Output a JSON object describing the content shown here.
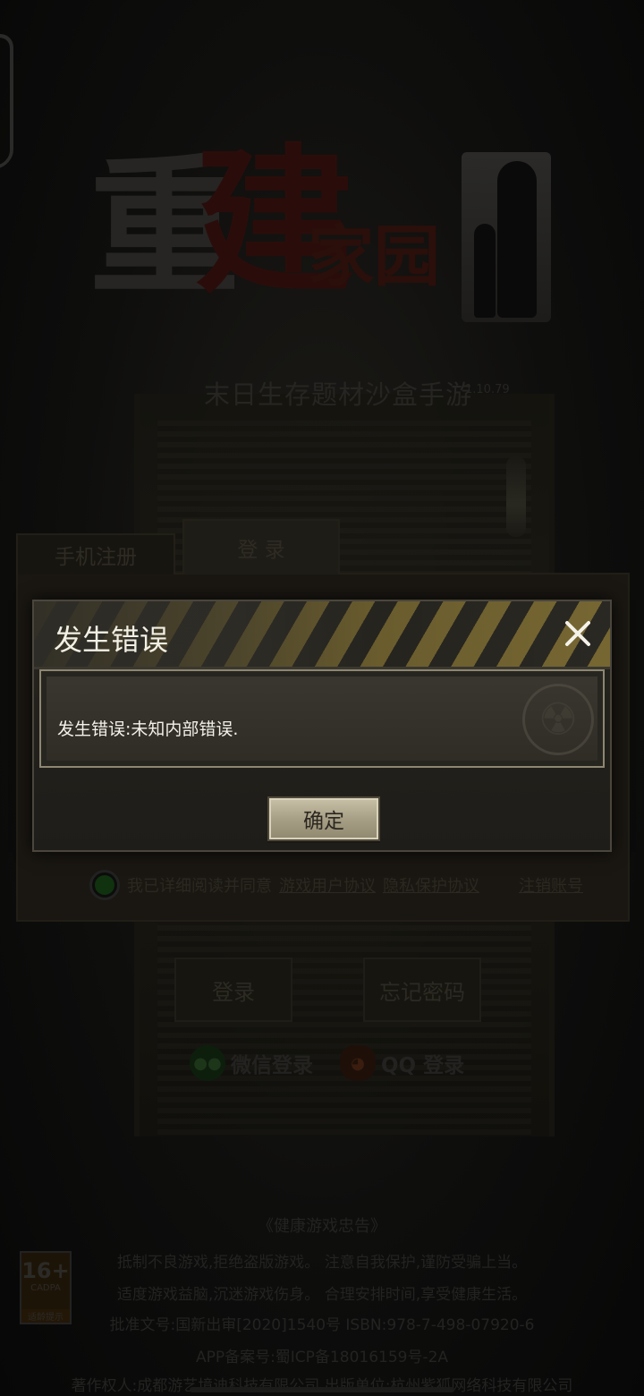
{
  "background": {
    "logo": {
      "char1": "重",
      "char2": "建",
      "rest": "家园"
    },
    "subtitle": "末日生存题材沙盒手游",
    "version": "1.10.79",
    "tabs": {
      "register": "手机注册",
      "login": "登 录"
    },
    "agreement": {
      "text": "我已详细阅读并同意",
      "user_agreement": "游戏用户协议",
      "privacy": "隐私保护协议",
      "cancel_account": "注销账号"
    },
    "buttons": {
      "login": "登录",
      "forgot": "忘记密码"
    },
    "social": {
      "wechat": "微信登录",
      "qq": "QQ 登录"
    },
    "health": {
      "title": "《健康游戏忠告》",
      "lines": [
        "抵制不良游戏,拒绝盗版游戏。 注意自我保护,谨防受骗上当。",
        "适度游戏益脑,沉迷游戏伤身。 合理安排时间,享受健康生活。",
        "批准文号:国新出审[2020]1540号    ISBN:978-7-498-07920-6",
        "APP备案号:蜀ICP备18016159号-2A",
        "著作权人:成都游艺境迪科技有限公司 出版单位:杭州紫狐网络科技有限公司"
      ]
    },
    "age_badge": {
      "rating": "16+",
      "org": "CADPA",
      "tip": "适龄提示"
    }
  },
  "dialog": {
    "title": "发生错误",
    "message": "发生错误:未知内部错误.",
    "confirm_label": "确定"
  },
  "colors": {
    "hazard_yellow": "#7c6c35",
    "dialog_bg": "#26241f",
    "confirm_bg": "#c9c1a7"
  },
  "icons": {
    "close": "close-icon",
    "radiation": "radiation-icon",
    "wechat": "wechat-icon",
    "qq": "qq-icon"
  }
}
